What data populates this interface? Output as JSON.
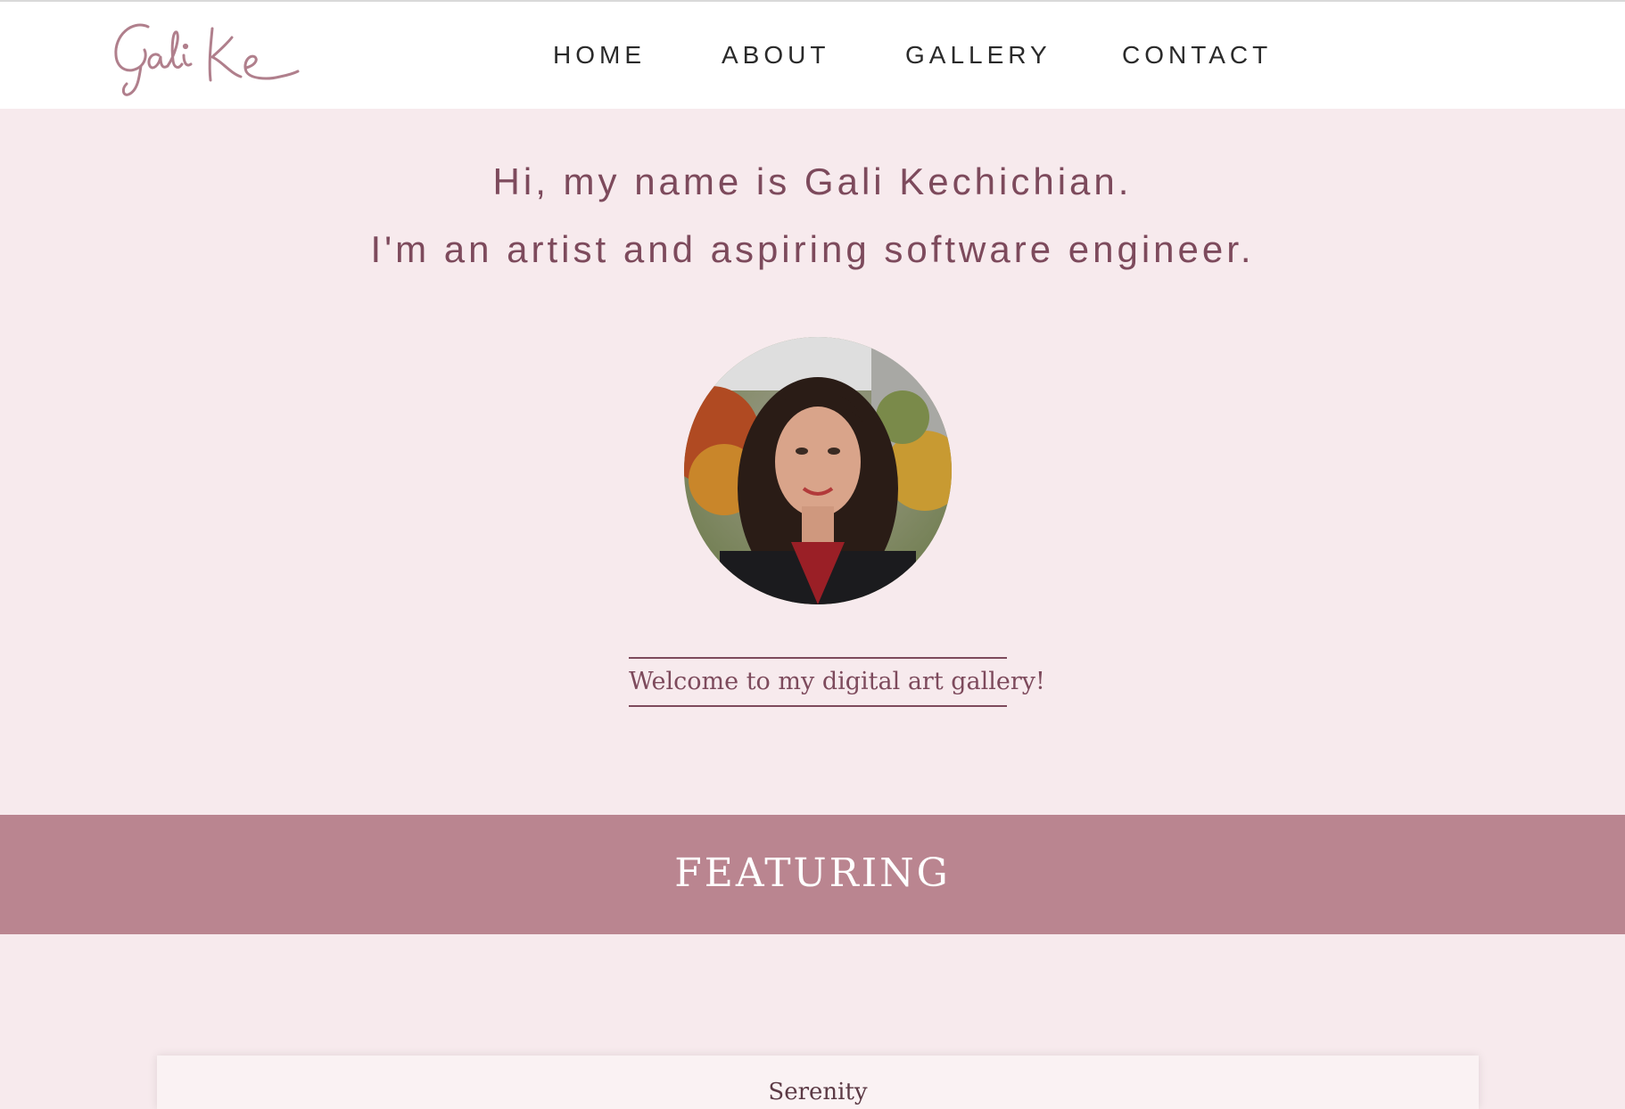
{
  "header": {
    "logo_text": "Gali Ke",
    "nav": [
      {
        "label": "HOME"
      },
      {
        "label": "ABOUT"
      },
      {
        "label": "GALLERY"
      },
      {
        "label": "CONTACT"
      }
    ]
  },
  "hero": {
    "line1": "Hi, my name is Gali Kechichian.",
    "line2": "I'm an artist and aspiring software engineer.",
    "welcome": "Welcome to my digital art gallery!"
  },
  "featuring": {
    "title": "FEATURING"
  },
  "gallery": {
    "first_card_title": "Serenity"
  },
  "colors": {
    "accent": "#ba8590",
    "text": "#7d4a5c",
    "background": "#f7eaed"
  }
}
